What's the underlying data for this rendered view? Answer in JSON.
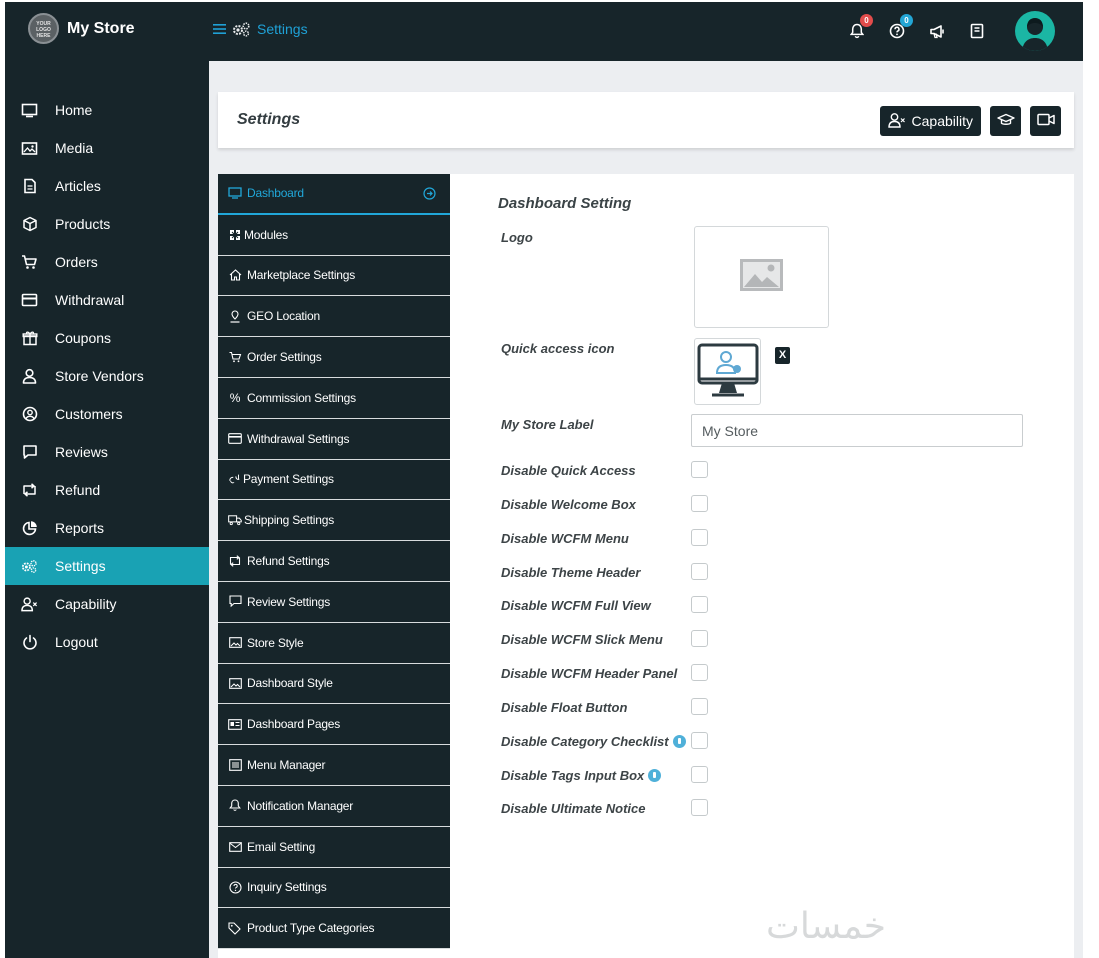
{
  "topbar": {
    "logo_text": "YOUR LOGO HERE",
    "store_name": "My Store",
    "breadcrumb": "Settings",
    "notifications_count": "0",
    "help_count": "0"
  },
  "sidebar": {
    "items": [
      {
        "label": "Home",
        "icon": "monitor-icon"
      },
      {
        "label": "Media",
        "icon": "image-icon"
      },
      {
        "label": "Articles",
        "icon": "document-icon"
      },
      {
        "label": "Products",
        "icon": "cube-icon"
      },
      {
        "label": "Orders",
        "icon": "cart-icon"
      },
      {
        "label": "Withdrawal",
        "icon": "credit-card-icon"
      },
      {
        "label": "Coupons",
        "icon": "gift-icon"
      },
      {
        "label": "Store Vendors",
        "icon": "user-icon"
      },
      {
        "label": "Customers",
        "icon": "user-circle-icon"
      },
      {
        "label": "Reviews",
        "icon": "comment-icon"
      },
      {
        "label": "Refund",
        "icon": "retweet-icon"
      },
      {
        "label": "Reports",
        "icon": "pie-chart-icon"
      },
      {
        "label": "Settings",
        "icon": "cogs-icon",
        "active": true
      },
      {
        "label": "Capability",
        "icon": "user-x-icon"
      },
      {
        "label": "Logout",
        "icon": "power-icon"
      }
    ]
  },
  "header": {
    "title": "Settings",
    "capability_button": "Capability"
  },
  "subnav": {
    "items": [
      {
        "label": "Dashboard",
        "icon": "monitor-icon",
        "active": true
      },
      {
        "label": "Modules",
        "icon": "modules-icon"
      },
      {
        "label": "Marketplace Settings",
        "icon": "home-icon"
      },
      {
        "label": "GEO Location",
        "icon": "map-marker-icon"
      },
      {
        "label": "Order Settings",
        "icon": "cart-icon"
      },
      {
        "label": "Commission Settings",
        "icon": "percent-icon"
      },
      {
        "label": "Withdrawal Settings",
        "icon": "credit-card-icon"
      },
      {
        "label": "Payment Settings",
        "icon": "money-icon"
      },
      {
        "label": "Shipping Settings",
        "icon": "truck-icon"
      },
      {
        "label": "Refund Settings",
        "icon": "retweet-icon"
      },
      {
        "label": "Review Settings",
        "icon": "comment-icon"
      },
      {
        "label": "Store Style",
        "icon": "image-icon"
      },
      {
        "label": "Dashboard Style",
        "icon": "image-icon"
      },
      {
        "label": "Dashboard Pages",
        "icon": "id-card-icon"
      },
      {
        "label": "Menu Manager",
        "icon": "list-icon"
      },
      {
        "label": "Notification Manager",
        "icon": "bell-icon"
      },
      {
        "label": "Email Setting",
        "icon": "envelope-icon"
      },
      {
        "label": "Inquiry Settings",
        "icon": "question-circle-icon"
      },
      {
        "label": "Product Type Categories",
        "icon": "tags-icon"
      }
    ]
  },
  "dashboard_setting": {
    "section_title": "Dashboard Setting",
    "logo_label": "Logo",
    "quick_access_label": "Quick access icon",
    "remove_label": "X",
    "store_label_label": "My Store Label",
    "store_label_value": "My Store",
    "checkboxes": [
      {
        "label": "Disable Quick Access",
        "help": false
      },
      {
        "label": "Disable Welcome Box",
        "help": false
      },
      {
        "label": "Disable WCFM Menu",
        "help": false
      },
      {
        "label": "Disable Theme Header",
        "help": false
      },
      {
        "label": "Disable WCFM Full View",
        "help": false
      },
      {
        "label": "Disable WCFM Slick Menu",
        "help": false
      },
      {
        "label": "Disable WCFM Header Panel",
        "help": false
      },
      {
        "label": "Disable Float Button",
        "help": false
      },
      {
        "label": "Disable Category Checklist",
        "help": true
      },
      {
        "label": "Disable Tags Input Box",
        "help": true
      },
      {
        "label": "Disable Ultimate Notice",
        "help": false
      }
    ]
  },
  "watermark": "خمسات",
  "colors": {
    "dark": "#17252a",
    "accent": "#19a2b4",
    "link": "#21a7d9"
  }
}
